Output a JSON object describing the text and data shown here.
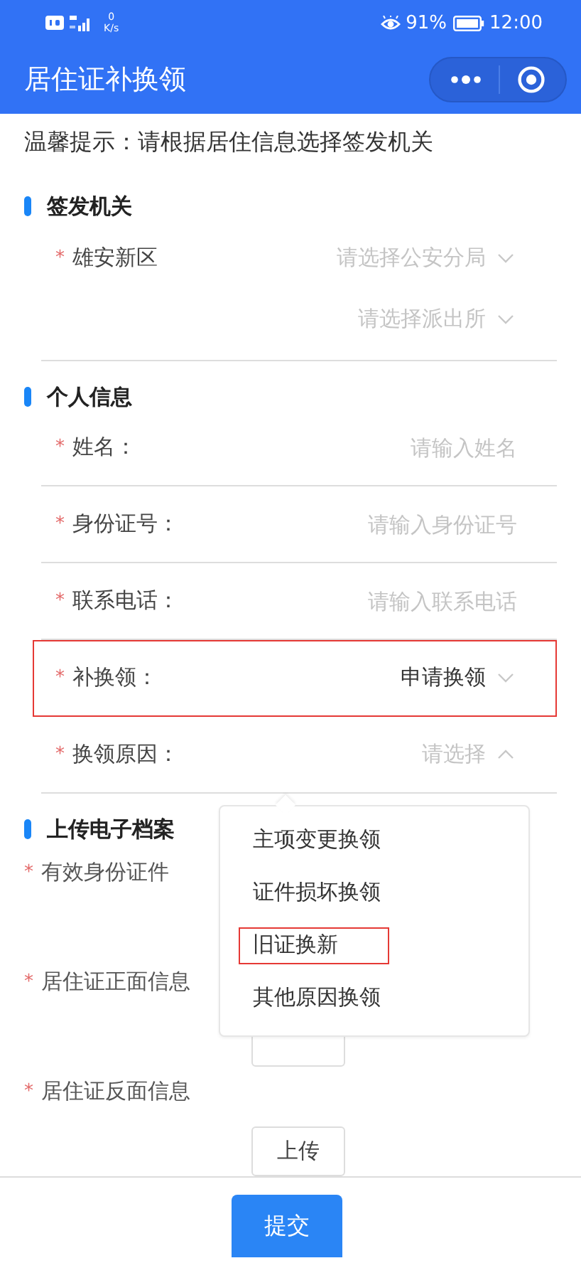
{
  "status_bar": {
    "network_speed": "0",
    "speed_unit": "K/s",
    "battery": "91%",
    "time": "12:00"
  },
  "nav_bar": {
    "title": "居住证补换领"
  },
  "notice": "温馨提示：请根据居住信息选择签发机关",
  "sections": [
    {
      "title": "签发机关",
      "rows": [
        {
          "kind": "cascade",
          "required": "*",
          "label": "雄安新区",
          "selects": [
            {
              "placeholder": "请选择公安分局"
            },
            {
              "placeholder": "请选择派出所"
            }
          ]
        }
      ]
    },
    {
      "title": "个人信息",
      "rows": [
        {
          "kind": "input",
          "required": "*",
          "label": "姓名：",
          "placeholder": "请输入姓名",
          "highlighted": false
        },
        {
          "kind": "input",
          "required": "*",
          "label": "身份证号：",
          "placeholder": "请输入身份证号",
          "highlighted": false
        },
        {
          "kind": "input",
          "required": "*",
          "label": "联系电话：",
          "placeholder": "请输入联系电话",
          "highlighted": false
        },
        {
          "kind": "select",
          "required": "*",
          "label": "补换领：",
          "value": "申请换领",
          "expanded": false,
          "highlighted": true
        },
        {
          "kind": "select",
          "required": "*",
          "label": "换领原因：",
          "placeholder": "请选择",
          "expanded": true,
          "highlighted": false,
          "options": [
            {
              "label": "主项变更换领",
              "highlighted": false
            },
            {
              "label": "证件损坏换领",
              "highlighted": false
            },
            {
              "label": "旧证换新",
              "highlighted": true
            },
            {
              "label": "其他原因换领",
              "highlighted": false
            }
          ]
        }
      ]
    },
    {
      "title": "上传电子档案",
      "rows": [
        {
          "kind": "upload",
          "required": "*",
          "label": "有效身份证件"
        },
        {
          "kind": "upload",
          "required": "*",
          "label": "居住证正面信息",
          "covered_button": true
        },
        {
          "kind": "upload",
          "required": "*",
          "label": "居住证反面信息",
          "button": "上传"
        }
      ]
    }
  ],
  "submit_button": "提交"
}
